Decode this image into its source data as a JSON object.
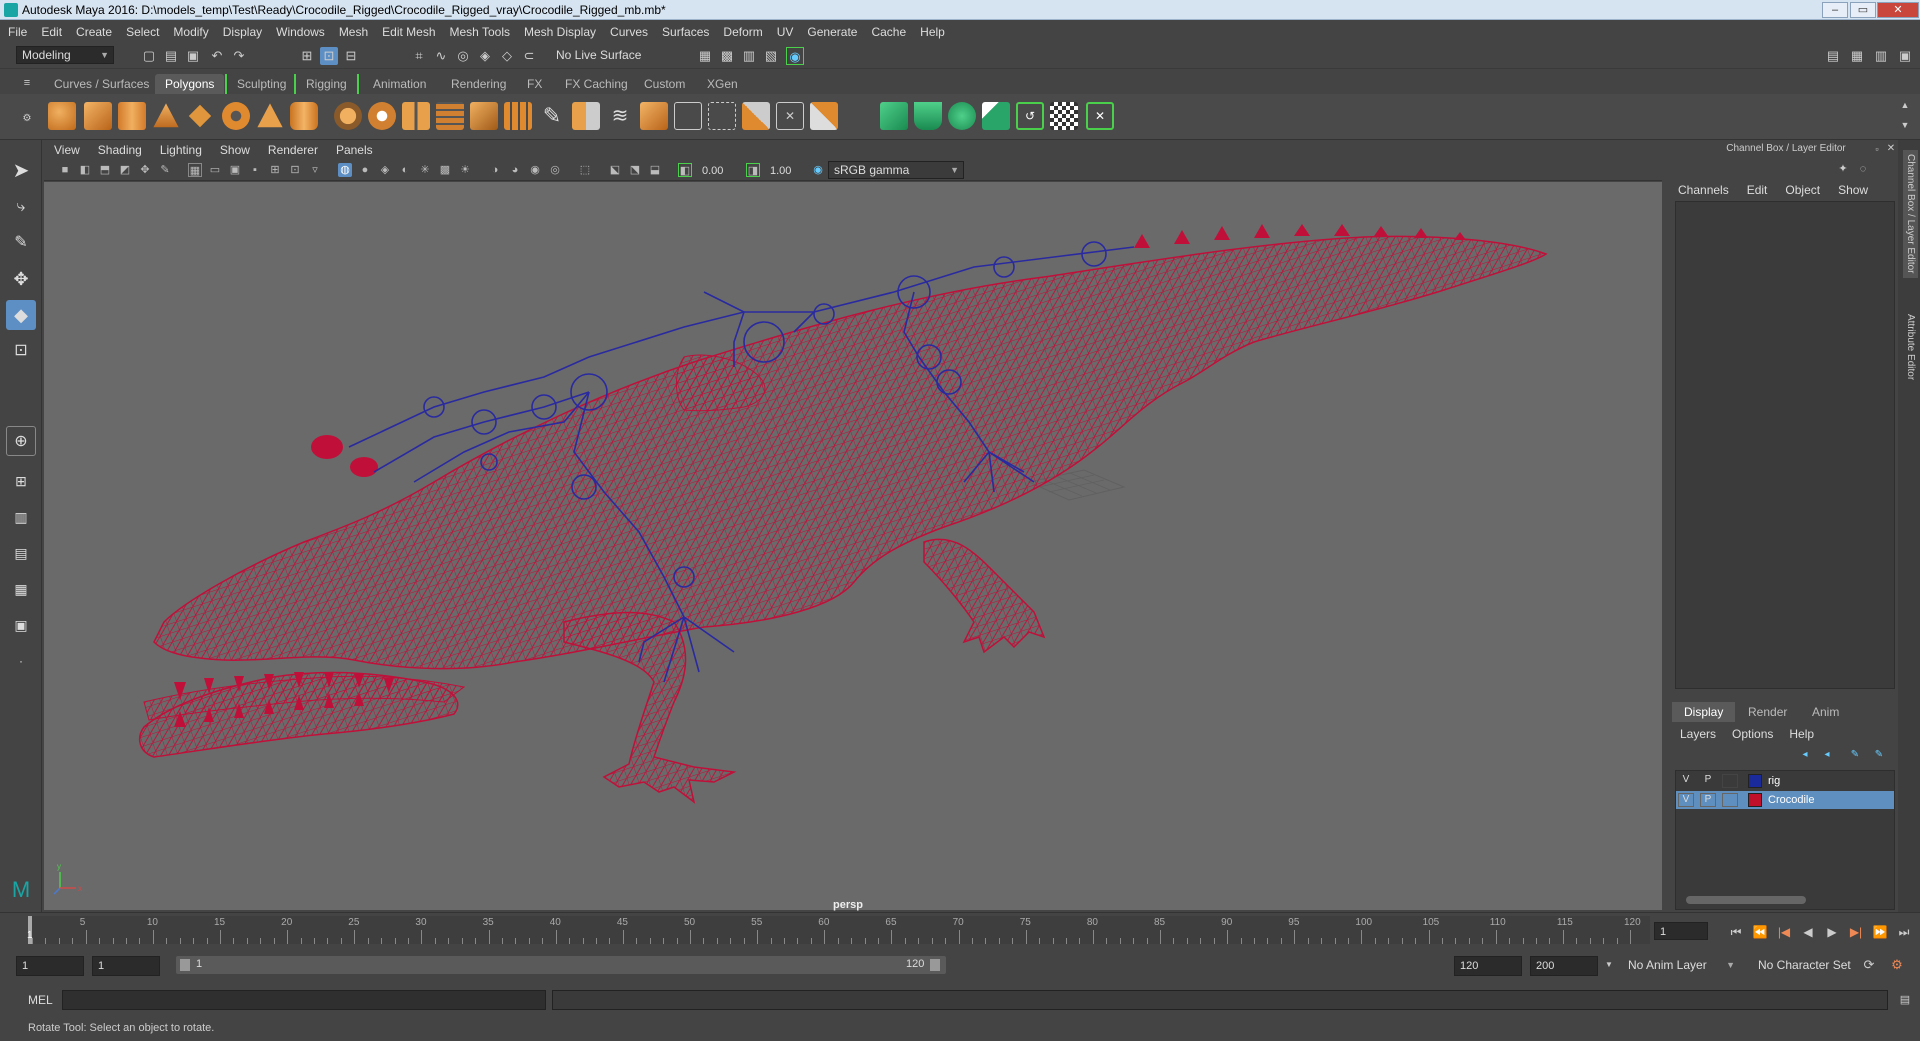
{
  "window": {
    "title": "Autodesk Maya 2016: D:\\models_temp\\Test\\Ready\\Crocodile_Rigged\\Crocodile_Rigged_vray\\Crocodile_Rigged_mb.mb*"
  },
  "menubar": [
    "File",
    "Edit",
    "Create",
    "Select",
    "Modify",
    "Display",
    "Windows",
    "Mesh",
    "Edit Mesh",
    "Mesh Tools",
    "Mesh Display",
    "Curves",
    "Surfaces",
    "Deform",
    "UV",
    "Generate",
    "Cache",
    "Help"
  ],
  "statusline": {
    "menuset": "Modeling",
    "live_surface": "No Live Surface"
  },
  "shelf_tabs": [
    "Curves / Surfaces",
    "Polygons",
    "Sculpting",
    "Rigging",
    "Animation",
    "Rendering",
    "FX",
    "FX Caching",
    "Custom",
    "XGen"
  ],
  "panel_menu": [
    "View",
    "Shading",
    "Lighting",
    "Show",
    "Renderer",
    "Panels"
  ],
  "panel_tools": {
    "exposure": "0.00",
    "gamma": "1.00",
    "colorspace": "sRGB gamma"
  },
  "viewport": {
    "camera": "persp"
  },
  "channel_box": {
    "title": "Channel Box / Layer Editor",
    "menu": [
      "Channels",
      "Edit",
      "Object",
      "Show"
    ],
    "side_tab_1": "Channel Box / Layer Editor",
    "side_tab_2": "Attribute Editor"
  },
  "layer_editor": {
    "tabs": [
      "Display",
      "Render",
      "Anim"
    ],
    "menu": [
      "Layers",
      "Options",
      "Help"
    ],
    "layers": [
      {
        "v": "V",
        "p": "P",
        "name": "rig",
        "color": "#1a2a9a"
      },
      {
        "v": "V",
        "p": "P",
        "name": "Crocodile",
        "color": "#c0102a"
      }
    ]
  },
  "timeline": {
    "ticks": [
      "5",
      "10",
      "15",
      "20",
      "25",
      "30",
      "35",
      "40",
      "45",
      "50",
      "55",
      "60",
      "65",
      "70",
      "75",
      "80",
      "85",
      "90",
      "95",
      "100",
      "105",
      "110",
      "115",
      "120"
    ],
    "current_marker": "1",
    "current_frame": "1"
  },
  "range": {
    "start": "1",
    "playback_start": "1",
    "slider_start": "1",
    "slider_end": "120",
    "playback_end": "120",
    "end": "200",
    "anim_layer": "No Anim Layer",
    "char_set": "No Character Set"
  },
  "mel": {
    "label": "MEL"
  },
  "help_line": "Rotate Tool: Select an object to rotate.",
  "colors": {
    "mesh": "#c0103a",
    "skeleton": "#2a2aa0",
    "accent": "#5d8fc4"
  }
}
